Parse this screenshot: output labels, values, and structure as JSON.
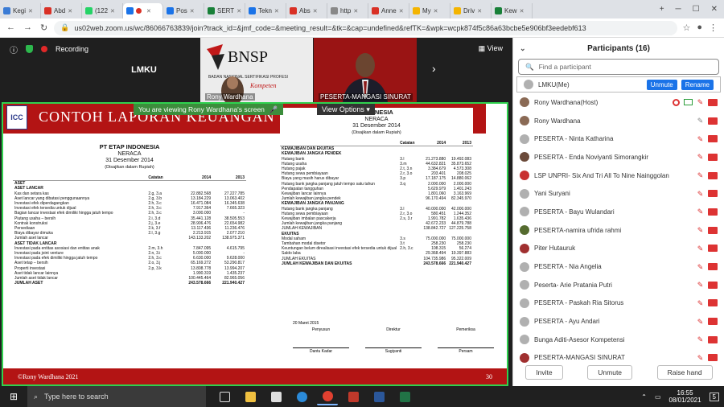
{
  "browser": {
    "tabs": [
      {
        "label": "Kegi",
        "color": "#3a7bd5"
      },
      {
        "label": "Abd",
        "color": "#d93025"
      },
      {
        "label": "(122",
        "color": "#25d366"
      },
      {
        "label": "",
        "color": "#1a73e8",
        "active": true
      },
      {
        "label": "Pos",
        "color": "#1a73e8"
      },
      {
        "label": "SERT",
        "color": "#188038"
      },
      {
        "label": "Tekn",
        "color": "#1a73e8"
      },
      {
        "label": "Abs",
        "color": "#d93025"
      },
      {
        "label": "http",
        "color": "#888888"
      },
      {
        "label": "Anne",
        "color": "#d93025"
      },
      {
        "label": "My",
        "color": "#f4b400"
      },
      {
        "label": "Driv",
        "color": "#f4b400"
      },
      {
        "label": "Kew",
        "color": "#188038"
      }
    ],
    "url": "us02web.zoom.us/wc/86066763839/join?track_id=&jmf_code=&meeting_result=&tk=&cap=undefined&refTK=&wpk=wcpk874f5c86a63bcbe5e906bf3eedebf613"
  },
  "meeting": {
    "recording_label": "Recording",
    "view_label": "View",
    "tiles": {
      "lmku": "LMKU",
      "rony": "Rony Wardhana",
      "mangasi": "PESERTA-MANGASI SINURAT",
      "bnsp_logo": "BNSP",
      "bnsp_sub1": "BADAN NASIONAL SERTIFIKASI PROFESI",
      "bnsp_sub2": "Kompeten"
    },
    "share_banner": "You are viewing Rony Wardhana's screen",
    "view_options": "View Options ▾"
  },
  "slide": {
    "logo": "ICC",
    "title": "CONTOH LAPORAN KEUANGAN",
    "footer_left": "©Rony Wardhana 2021",
    "footer_right": "30",
    "left": {
      "company": "PT ETAP INDONESIA",
      "title": "NERACA",
      "date": "31 Desember 2014",
      "note": "(Disajikan dalam Rupiah)",
      "headers": [
        "",
        "Catatan",
        "2014",
        "2013"
      ],
      "rows": [
        {
          "h": true,
          "c": [
            "ASET",
            "",
            "",
            ""
          ]
        },
        {
          "h": true,
          "c": [
            "ASET LANCAR",
            "",
            "",
            ""
          ]
        },
        {
          "c": [
            "Kas dan setara kas",
            "2.g, 3.a",
            "22.882.568",
            "27.227.785"
          ]
        },
        {
          "c": [
            "Aset lancar yang dibatasi penggunaannya",
            "2.g, 3.b",
            "13.184.229",
            "13.063.402"
          ]
        },
        {
          "c": [
            "Investasi efek diperdagangkan",
            "2.h, 3.c",
            "16.471.084",
            "16.345.638"
          ]
        },
        {
          "c": [
            "Investasi efek tersedia untuk dijual",
            "2.h, 3.c",
            "7.917.364",
            "7.665.323"
          ]
        },
        {
          "c": [
            "Bagian lancar investasi efek dimiliki hingga jatuh tempo",
            "2.h, 3.c",
            "3.000.000",
            "-"
          ]
        },
        {
          "c": [
            "Piutang usaha – bersih",
            "2.i, 3.d",
            "35.441.128",
            "38.505.553"
          ]
        },
        {
          "c": [
            "Kontrak konstruksi",
            "2.j, 3.e",
            "28.906.476",
            "22.654.982"
          ]
        },
        {
          "c": [
            "Persediaan",
            "2.k, 3.f",
            "13.117.436",
            "11.236.476"
          ]
        },
        {
          "c": [
            "Biaya dibayar dimuka",
            "2.l, 3.g",
            "2.213.915",
            "2.077.210"
          ]
        },
        {
          "c": [
            "Jumlah aset lancar",
            "",
            "143.133.202",
            "138.975.371"
          ]
        },
        {
          "c": [
            "",
            "",
            "",
            ""
          ]
        },
        {
          "h": true,
          "c": [
            "ASET TIDAK LANCAR",
            "",
            "",
            ""
          ]
        },
        {
          "c": [
            "",
            "",
            "",
            ""
          ]
        },
        {
          "c": [
            "Investasi pada entitas asosiasi dan entitas anak",
            "2.m, 3.h",
            "7.847.095",
            "4.615.795"
          ]
        },
        {
          "c": [
            "Investasi pada joint venture",
            "2.n, 3.i",
            "5.000.000",
            "-"
          ]
        },
        {
          "c": [
            "Investasi pada efek dimiliki hingga jatuh tempo",
            "2.h, 3.c",
            "6.630.000",
            "9.628.000"
          ]
        },
        {
          "c": [
            "Aset tetap – bersih",
            "2.o, 3.j",
            "65.169.272",
            "53.290.817"
          ]
        },
        {
          "c": [
            "Properti investasi",
            "2.p, 3.k",
            "13.808.778",
            "13.994.207"
          ]
        },
        {
          "c": [
            "",
            "",
            "",
            ""
          ]
        },
        {
          "c": [
            "Aset tidak lancar lainnya",
            "",
            "1.990.319",
            "1.435.237"
          ]
        },
        {
          "c": [
            "Jumlah aset tidak lancar",
            "",
            "100.445.464",
            "82.965.056"
          ]
        },
        {
          "h": true,
          "c": [
            "JUMLAH ASET",
            "",
            "243.578.666",
            "221.940.427"
          ]
        }
      ]
    },
    "right": {
      "company": "INDONESIA",
      "title": "NERACA",
      "date": "31 Desember 2014",
      "note": "(Disajikan dalam Rupiah)",
      "headers": [
        "",
        "Catatan",
        "2014",
        "2013"
      ],
      "rows": [
        {
          "h": true,
          "c": [
            "KEWAJIBAN DAN EKUITAS",
            "",
            "",
            ""
          ]
        },
        {
          "h": true,
          "c": [
            "KEWAJIBAN JANGKA PENDEK",
            "",
            "",
            ""
          ]
        },
        {
          "c": [
            "Hutang bank",
            "3.l",
            "21.273.880",
            "19.492.083"
          ]
        },
        {
          "c": [
            "Hutang usaha",
            "3.m",
            "44.632.821",
            "35.873.652"
          ]
        },
        {
          "c": [
            "Hutang pajak",
            "2.t, 3.n",
            "3.384.679",
            "4.573.308"
          ]
        },
        {
          "c": [
            "Hutang sewa pembiayaan",
            "2.r, 3.o",
            "203.401",
            "208.025"
          ]
        },
        {
          "c": [
            "Biaya yang masih harus dibayar",
            "3.p",
            "17.187.175",
            "14.880.062"
          ]
        },
        {
          "c": [
            "Hutang bank jangka panjang jatuh tempo satu tahun",
            "3.q",
            "2.000.000",
            "2.000.000"
          ]
        },
        {
          "c": [
            "Pendapatan tangguhan",
            "",
            "5.629.979",
            "1.401.243"
          ]
        },
        {
          "c": [
            "Kewajiban lancar lainnya",
            "",
            "1.801.060",
            "3.163.969"
          ]
        },
        {
          "c": [
            "Jumlah kewajiban jangka pendek",
            "",
            "96.170.494",
            "82.345.970"
          ]
        },
        {
          "c": [
            "",
            "",
            "",
            ""
          ]
        },
        {
          "h": true,
          "c": [
            "KEWAJIBAN JANGKA PANJANG",
            "",
            "",
            ""
          ]
        },
        {
          "c": [
            "",
            "",
            "",
            ""
          ]
        },
        {
          "c": [
            "Hutang bank jangka panjang",
            "3.l",
            "40.000.000",
            "42.000.000"
          ]
        },
        {
          "c": [
            "Hutang sewa pembiayaan",
            "2.r, 3.o",
            "580.451",
            "1.244.352"
          ]
        },
        {
          "c": [
            "Kewajiban imbalan pascakerja",
            "2.s, 3.r",
            "1.991.782",
            "1.635.436"
          ]
        },
        {
          "c": [
            "Jumlah kewajiban jangka panjang",
            "",
            "42.672.233",
            "44.879.788"
          ]
        },
        {
          "c": [
            "JUMLAH KEWAJIBAN",
            "",
            "138.842.727",
            "127.225.758"
          ]
        },
        {
          "c": [
            "",
            "",
            "",
            ""
          ]
        },
        {
          "h": true,
          "c": [
            "EKUITAS",
            "",
            "",
            ""
          ]
        },
        {
          "c": [
            "Modal saham",
            "3.s",
            "75.000.000",
            "75.000.000"
          ]
        },
        {
          "c": [
            "Tambahan modal disetor",
            "3.t",
            "258.230",
            "258.230"
          ]
        },
        {
          "c": [
            "Keuntungan belum direalisasi investasi efek tersedia untuk dijual",
            "2.h, 3.c",
            "108.315",
            "56.274"
          ]
        },
        {
          "c": [
            "Saldo laba",
            "",
            "29.368.494",
            "19.397.883"
          ]
        },
        {
          "c": [
            "JUMLAH EKUITAS",
            "",
            "104.735.986",
            "95.322.009"
          ]
        },
        {
          "h": true,
          "c": [
            "JUMLAH KEWAJIBAN DAN EKUITAS",
            "",
            "243.578.666",
            "221.940.427"
          ]
        }
      ],
      "date_signed": "20 Maret 2015",
      "signers": [
        {
          "role": "Penyusun",
          "name": "Dantu Kadar"
        },
        {
          "role": "Direktur",
          "name": "Sugiyanti"
        },
        {
          "role": "Pemeriksa",
          "name": "Persam"
        }
      ]
    }
  },
  "participants": {
    "title": "Participants (16)",
    "search_placeholder": "Find a participant",
    "unmute_label": "Unmute",
    "rename_label": "Rename",
    "list": [
      {
        "name": "LMKU(Me)",
        "me": true,
        "avatar": "#b0b0b0"
      },
      {
        "name": "Rony Wardhana(Host)",
        "avatar": "#8a6a55",
        "host": true
      },
      {
        "name": "Rony Wardhana",
        "avatar": "#8a6a55"
      },
      {
        "name": "PESERTA - Ninta Katharina",
        "avatar": "#b0b0b0"
      },
      {
        "name": "PESERTA - Enda Noviyanti Simorangkir",
        "avatar": "#6b4a3a"
      },
      {
        "name": "LSP UNPRI- Six And Tri All To Nine Nainggolan",
        "avatar": "#c83030"
      },
      {
        "name": "Yani Suryani",
        "avatar": "#b0b0b0"
      },
      {
        "name": "PESERTA - Bayu Wulandari",
        "avatar": "#b0b0b0"
      },
      {
        "name": "PESERTA-namira ufrida rahmi",
        "avatar": "#556b2f"
      },
      {
        "name": "Piter Hutauruk",
        "avatar": "#a03030"
      },
      {
        "name": "PESERTA - Nia Angelia",
        "avatar": "#b0b0b0"
      },
      {
        "name": "Peserta- Arie Pratania Putri",
        "avatar": "#b0b0b0"
      },
      {
        "name": "PESERTA - Paskah Ria Sitorus",
        "avatar": "#b0b0b0"
      },
      {
        "name": "PESERTA - Ayu Andari",
        "avatar": "#b0b0b0"
      },
      {
        "name": "Bunga Aditi-Asesor Kompetensi",
        "avatar": "#b0b0b0"
      },
      {
        "name": "PESERTA-MANGASI SINURAT",
        "avatar": "#a03030"
      }
    ],
    "buttons": {
      "invite": "Invite",
      "unmute": "Unmute",
      "raise": "Raise hand"
    }
  },
  "taskbar": {
    "search": "Type here to search",
    "time": "16:55",
    "date": "08/01/2021",
    "notif": "5"
  }
}
